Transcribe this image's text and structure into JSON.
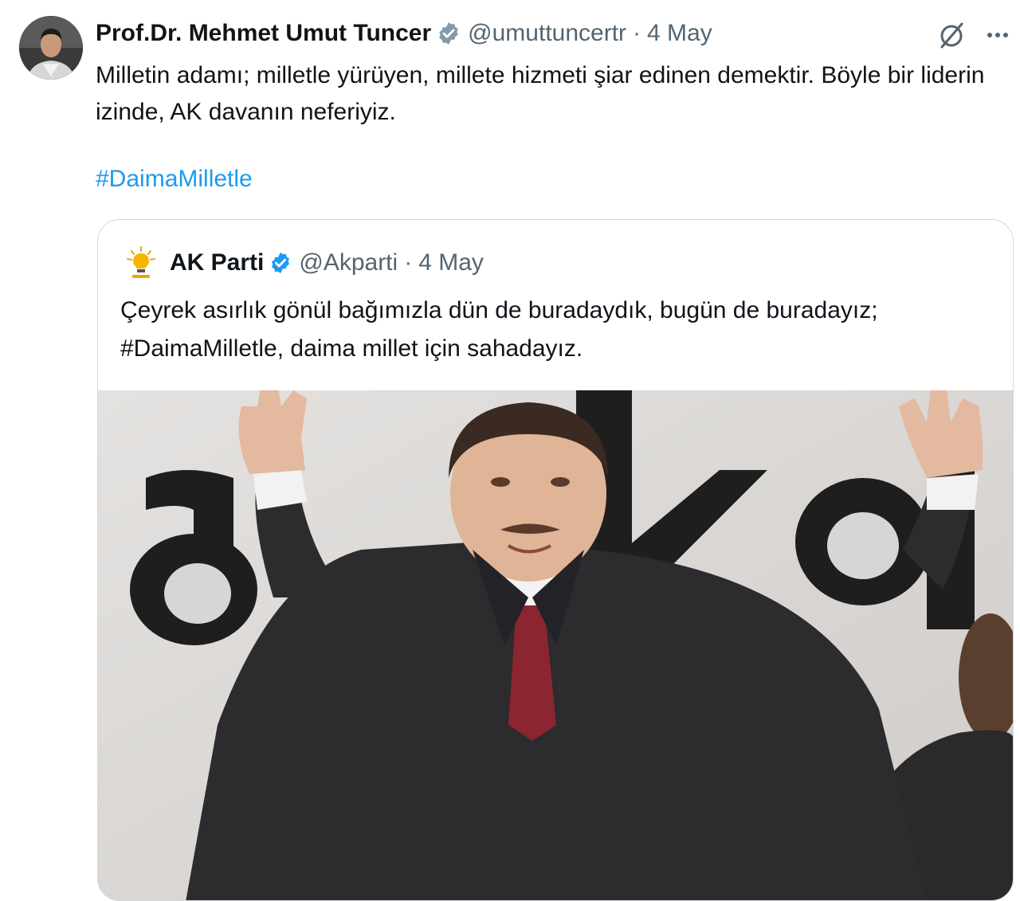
{
  "tweet": {
    "author_name": "Prof.Dr. Mehmet Umut Tuncer",
    "handle": "@umuttuncertr",
    "separator": "·",
    "date": "4 May",
    "text": "Milletin adamı; milletle yürüyen, millete hizmeti şiar edinen demektir. Böyle bir liderin izinde, AK davanın neferiyiz.",
    "hashtag": "#DaimaMilletle"
  },
  "quoted": {
    "author_name": "AK Parti",
    "handle": "@Akparti",
    "separator": "·",
    "date": "4 May",
    "text": "Çeyrek asırlık gönül bağımızla dün de buradaydık, bugün de buradayız; #DaimaMilletle, daima millet için sahadayız."
  },
  "icons": {
    "avatar": "profile-photo",
    "verified": "verified-badge-icon",
    "grok": "grok-icon",
    "more": "more-options-icon",
    "party_logo": "ak-parti-lightbulb-icon"
  },
  "colors": {
    "text": "#0f1419",
    "secondary": "#536471",
    "link": "#1d9bf0",
    "border": "#cfd9de",
    "verified": "#1d9bf0"
  }
}
